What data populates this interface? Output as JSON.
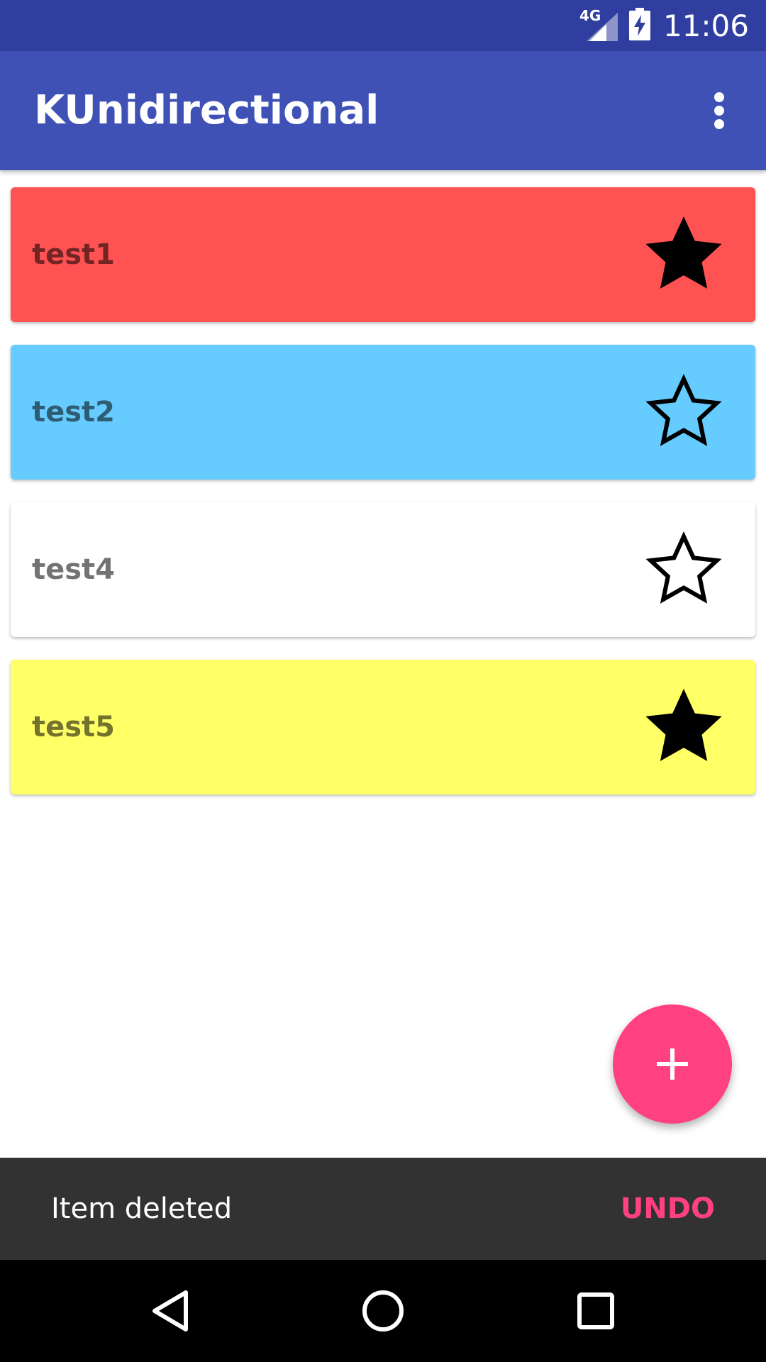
{
  "status_bar": {
    "network": "4G",
    "time": "11:06"
  },
  "app_bar": {
    "title": "KUnidirectional",
    "overflow_icon": "more-vert-icon"
  },
  "items": [
    {
      "label": "test1",
      "color": "#ff5252",
      "starred": true
    },
    {
      "label": "test2",
      "color": "#66ccff",
      "starred": false
    },
    {
      "label": "test4",
      "color": "#ffffff",
      "starred": false
    },
    {
      "label": "test5",
      "color": "#ffff66",
      "starred": true
    }
  ],
  "fab": {
    "icon": "plus-icon",
    "color": "#ff4081"
  },
  "snackbar": {
    "message": "Item deleted",
    "action": "UNDO"
  },
  "nav_bar": {
    "icons": [
      "back-icon",
      "home-icon",
      "recents-icon"
    ]
  },
  "colors": {
    "primary": "#3f51b5",
    "primary_dark": "#303f9f",
    "accent": "#ff4081"
  }
}
